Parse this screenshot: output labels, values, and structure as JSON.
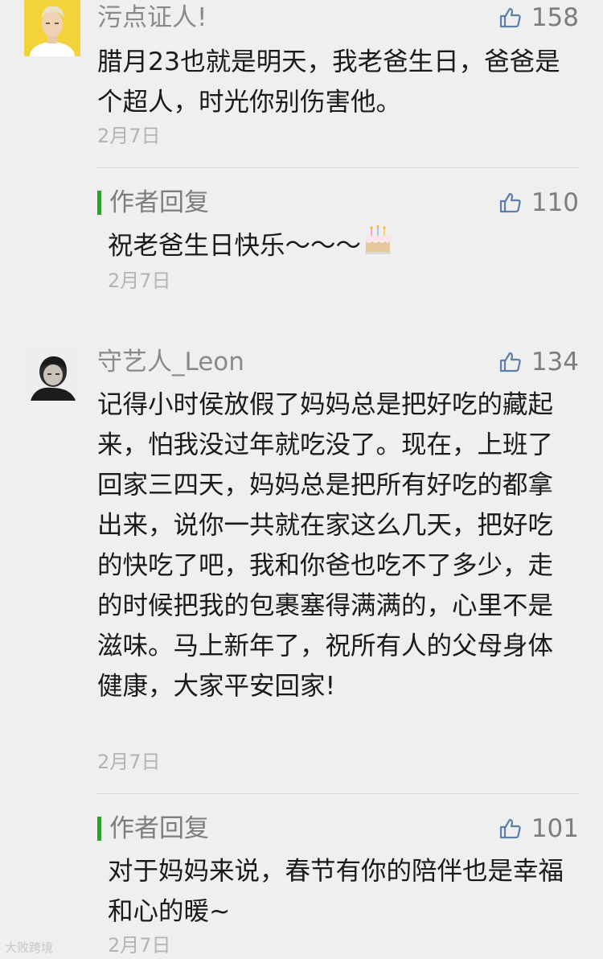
{
  "comments": [
    {
      "nickname": "污点证人!",
      "likes": "158",
      "text": "腊月23也就是明天，我老爸生日，爸爸是个超人，时光你别伤害他。",
      "date": "2月7日",
      "reply": {
        "label": "作者回复",
        "likes": "110",
        "text": "祝老爸生日快乐～～～",
        "date": "2月7日"
      }
    },
    {
      "nickname": "守艺人_Leon",
      "likes": "134",
      "text": "记得小时侯放假了妈妈总是把好吃的藏起来，怕我没过年就吃没了。现在，上班了回家三四天，妈妈总是把所有好吃的都拿出来，说你一共就在家这么几天，把好吃的快吃了吧，我和你爸也吃不了多少，走的时候把我的包裹塞得满满的，心里不是滋味。马上新年了，祝所有人的父母身体健康，大家平安回家!",
      "date": "2月7日",
      "reply": {
        "label": "作者回复",
        "likes": "101",
        "text": "对于妈妈来说，春节有你的陪伴也是幸福和心的暖~",
        "date": "2月7日"
      }
    }
  ],
  "icons": {
    "like": "thumbs-up-icon",
    "cake": "birthday-cake-emoji"
  },
  "colors": {
    "background": "#efefef",
    "reply_accent": "#1aad19",
    "muted_text": "#8a8a8a",
    "date_text": "#b3b3b3"
  },
  "watermark": "大败跨境"
}
